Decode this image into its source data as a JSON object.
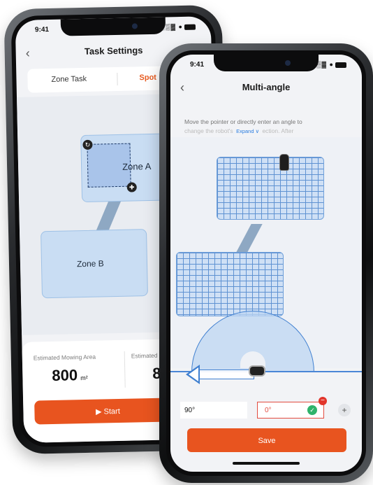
{
  "status": {
    "time": "9:41",
    "signal": "░▒▓ ●"
  },
  "back_glyph": "‹",
  "phone1": {
    "title": "Task Settings",
    "tabs": [
      {
        "label": "Zone Task"
      },
      {
        "label": "Spot"
      }
    ],
    "zones": [
      {
        "label": "Zone A"
      },
      {
        "label": "Zone B"
      }
    ],
    "estimated_area_label": "Estimated Mowing Area",
    "estimated_area_value": "800",
    "estimated_area_unit": "m²",
    "estimated2_label": "Estimated",
    "estimated2_value": "8",
    "start_label": "▶  Start"
  },
  "phone2": {
    "title": "Multi-angle",
    "description_line1": "Move the pointer or directly enter an angle to",
    "description_line2": "change the robot's",
    "description_line2_end": "ection. After",
    "expand_label": "Expand ∨",
    "angle1": "90°",
    "angle2": "0°",
    "save_label": "Save"
  },
  "colors": {
    "accent": "#e8541f",
    "zone_fill": "#c9ddf3",
    "grid_line": "#5f92d2"
  }
}
